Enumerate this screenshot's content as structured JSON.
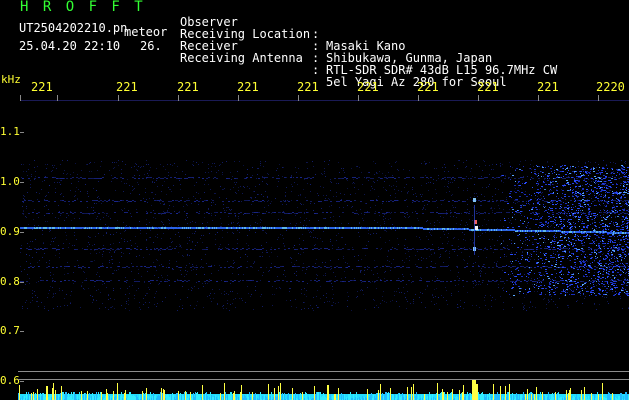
{
  "header": {
    "logo": "H R O F F T",
    "filename": "UT2504202210.pn",
    "date_time": "25.04.20 22:10",
    "label": "meteor",
    "frame_id": "26."
  },
  "info": [
    {
      "key": "Observer",
      "sep": ":",
      "value": "Masaki Kano"
    },
    {
      "key": "Receiving Location",
      "sep": ":",
      "value": "Shibukawa, Gunma, Japan"
    },
    {
      "key": "Receiver",
      "sep": ":",
      "value": "RTL-SDR SDR# 43dB L15 96.7MHz CW"
    },
    {
      "key": "Receiving Antenna",
      "sep": ":",
      "value": "5el Yagi Az 280 for Seoul"
    }
  ],
  "axis": {
    "unit": "kHz",
    "time_labels": [
      "221",
      "221",
      "221",
      "221",
      "221",
      "221",
      "221",
      "221",
      "221",
      "2220"
    ],
    "freq_labels": [
      "1.1",
      "1.0",
      "0.9",
      "0.8",
      "0.7",
      "0.6"
    ]
  },
  "colors": {
    "background": "#000000",
    "title_green": "#33ff33",
    "axis_yellow": "#ffff33",
    "signal_blue": "#3355ff",
    "signal_cyan": "#33ddff"
  }
}
